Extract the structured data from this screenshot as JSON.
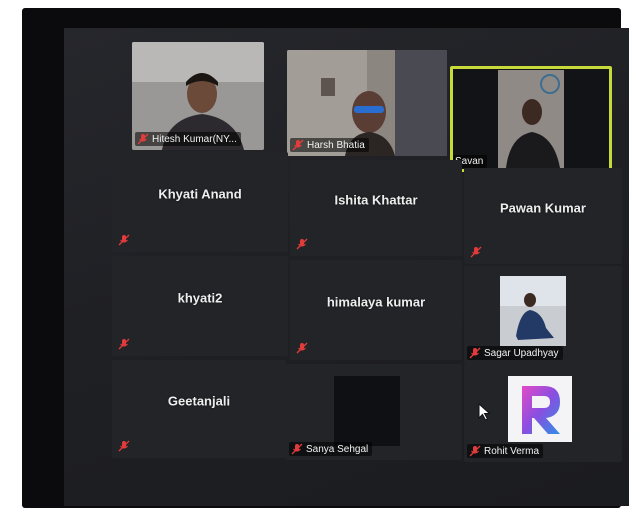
{
  "participants": [
    {
      "name": "Hitesh Kumar(NY...",
      "video": true
    },
    {
      "name": "Harsh Bhatia",
      "video": true
    },
    {
      "name": "Savan",
      "video": true,
      "active_speaker": true
    },
    {
      "name": "Khyati Anand",
      "video": false
    },
    {
      "name": "Ishita Khattar",
      "video": false
    },
    {
      "name": "Pawan Kumar",
      "video": false
    },
    {
      "name": "khyati2",
      "video": false
    },
    {
      "name": "himalaya kumar",
      "video": false
    },
    {
      "name": "Sagar Upadhyay",
      "video": false,
      "profile_picture": true
    },
    {
      "name": "Geetanjali",
      "video": false
    },
    {
      "name": "Sanya Sehgal",
      "video": false,
      "profile_picture": true
    },
    {
      "name": "Rohit Verma",
      "video": false,
      "profile_picture": true
    }
  ],
  "colors": {
    "active_speaker_border": "#c8d93a",
    "muted_icon": "#e23b3b",
    "tile_background": "#232428"
  },
  "icons": {
    "muted": "microphone-muted-icon",
    "cursor": "mouse-pointer-icon"
  }
}
